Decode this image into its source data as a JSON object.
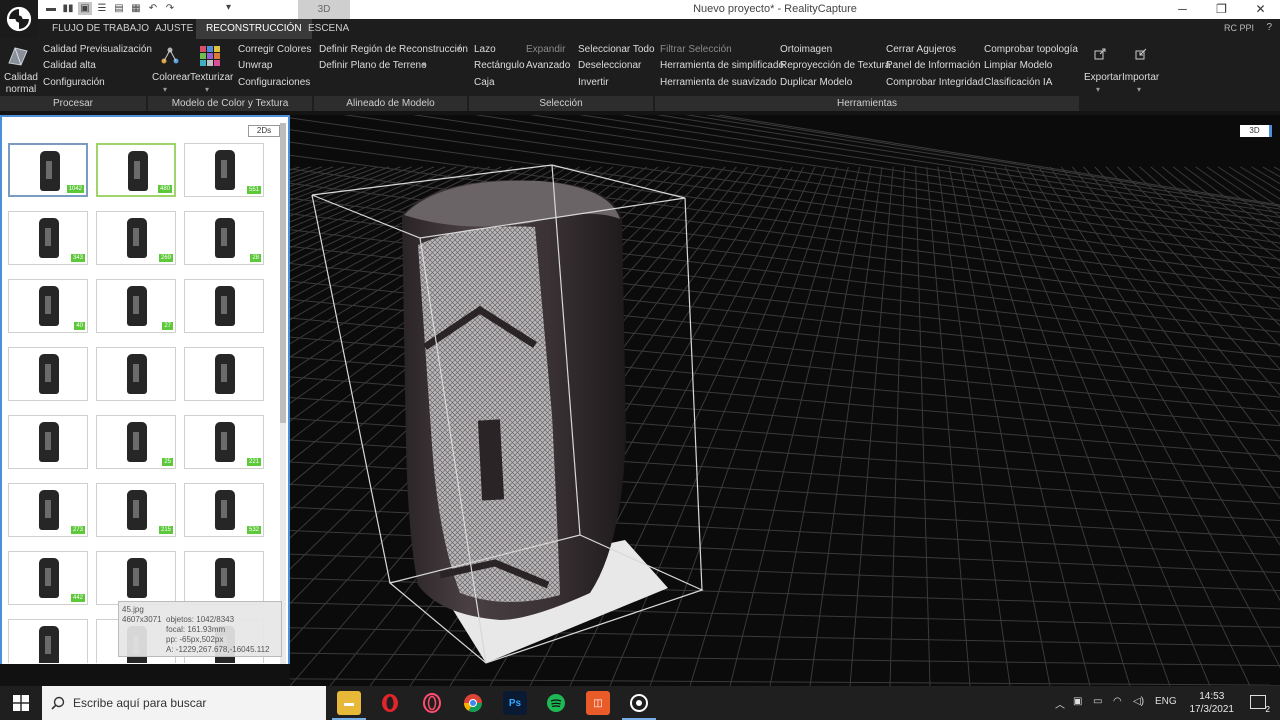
{
  "window": {
    "title": "Nuevo proyecto* - RealityCapture",
    "view_mode": "3D"
  },
  "tabs": [
    {
      "label": "FLUJO DE TRABAJO"
    },
    {
      "label": "AJUSTE"
    },
    {
      "label": "RECONSTRUCCIÓN",
      "active": true
    },
    {
      "label": "ESCENA"
    }
  ],
  "top_right": {
    "rc_ppi": "RC PPI",
    "help": "?"
  },
  "ribbon": {
    "process": {
      "big_label": "Calidad normal",
      "items": [
        "Calidad Previsualización",
        "Calidad alta",
        "Configuración"
      ],
      "group": "Procesar"
    },
    "color_texture": {
      "colorize": "Colorear",
      "texturize": "Texturizar",
      "items": [
        "Corregir Colores",
        "Unwrap",
        "Configuraciones"
      ],
      "group": "Modelo de Color y Textura"
    },
    "alignment": {
      "items": [
        "Definir Región de Reconstrucción",
        "Definir Plano de Terreno"
      ],
      "group": "Alineado de Modelo"
    },
    "selection": {
      "col1": [
        "Lazo",
        "Rectángulo",
        "Caja"
      ],
      "col2": [
        "Expandir",
        "Avanzado"
      ],
      "col3": [
        "Seleccionar Todo",
        "Deseleccionar",
        "Invertir"
      ],
      "group": "Selección"
    },
    "tools": {
      "col1": [
        "Filtrar Selección",
        "Herramienta de simplificado",
        "Herramienta de suavizado"
      ],
      "col2": [
        "Ortoimagen",
        "Reproyección de Textura",
        "Duplicar Modelo"
      ],
      "col3": [
        "Cerrar Agujeros",
        "Panel de Información",
        "Comprobar Integridad"
      ],
      "col4": [
        "Comprobar topología",
        "Limpiar Modelo",
        "Clasificación IA"
      ],
      "group": "Herramientas"
    },
    "export": "Exportar",
    "import": "Importar"
  },
  "panel2d": {
    "tag": "2Ds",
    "thumbnails": [
      {
        "badge": "1042"
      },
      {
        "badge": "480"
      },
      {
        "badge": "551"
      },
      {
        "badge": "343"
      },
      {
        "badge": "269"
      },
      {
        "badge": "28"
      },
      {
        "badge": "40"
      },
      {
        "badge": "27"
      },
      {
        "badge": ""
      },
      {
        "badge": ""
      },
      {
        "badge": ""
      },
      {
        "badge": ""
      },
      {
        "badge": ""
      },
      {
        "badge": "25"
      },
      {
        "badge": "221"
      },
      {
        "badge": "273"
      },
      {
        "badge": "215"
      },
      {
        "badge": "532"
      },
      {
        "badge": "442"
      },
      {
        "badge": ""
      },
      {
        "badge": ""
      },
      {
        "badge": ""
      },
      {
        "badge": ""
      },
      {
        "badge": ""
      }
    ],
    "tooltip": {
      "filename": "45.jpg",
      "resolution": "4607x3071",
      "objects": "objetos: 1042/8343",
      "focal": "focal: 161.93mm",
      "pp": "pp: -65px,502px",
      "position": "A: -1229,267.678,-16045.112"
    }
  },
  "viewport": {
    "tag": "3D"
  },
  "taskbar": {
    "search_placeholder": "Escribe aquí para buscar",
    "lang": "ENG",
    "time": "14:53",
    "date": "17/3/2021",
    "notifications": "2"
  }
}
